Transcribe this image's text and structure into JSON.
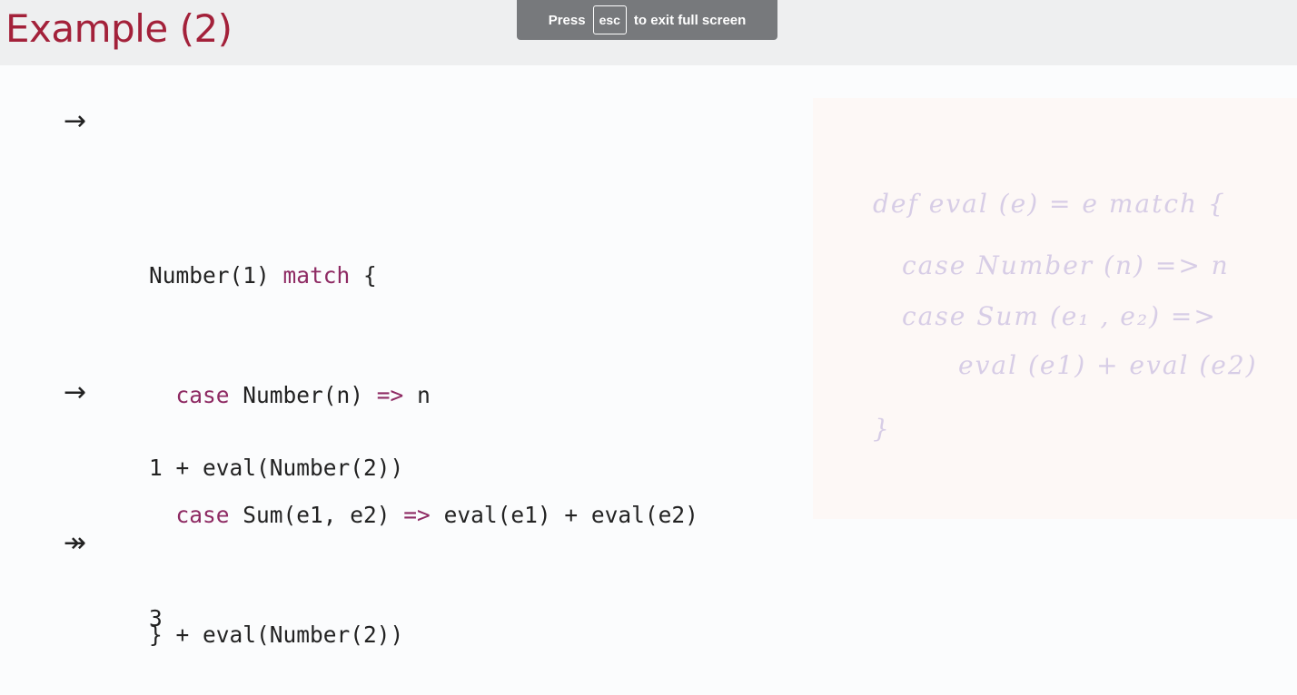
{
  "slide": {
    "title": "Example (2)"
  },
  "fullscreen_banner": {
    "prefix": "Press",
    "key": "esc",
    "suffix": "to exit full screen"
  },
  "steps": {
    "arrow1": "→",
    "arrow2": "→",
    "arrow3": "↠",
    "result_text": "1 + eval(Number(2))",
    "final_value": "3"
  },
  "code_block": {
    "line1_a": "Number(1) ",
    "line1_kw": "match",
    "line1_b": " {",
    "line2_indent": "  ",
    "line2_kw": "case",
    "line2_a": " Number(n) ",
    "line2_op": "=>",
    "line2_b": " n",
    "line3_indent": "  ",
    "line3_kw": "case",
    "line3_a": " Sum(e1, e2) ",
    "line3_op": "=>",
    "line3_b": " eval(e1) + eval(e2)",
    "line4": "} + eval(Number(2))"
  },
  "handwritten_notes": {
    "line1": "def eval (e) = e match {",
    "line2": "case Number (n) => n",
    "line3": "case Sum (e₁ , e₂) =>",
    "line4": "eval (e1) + eval (e2)",
    "line5": "}"
  }
}
